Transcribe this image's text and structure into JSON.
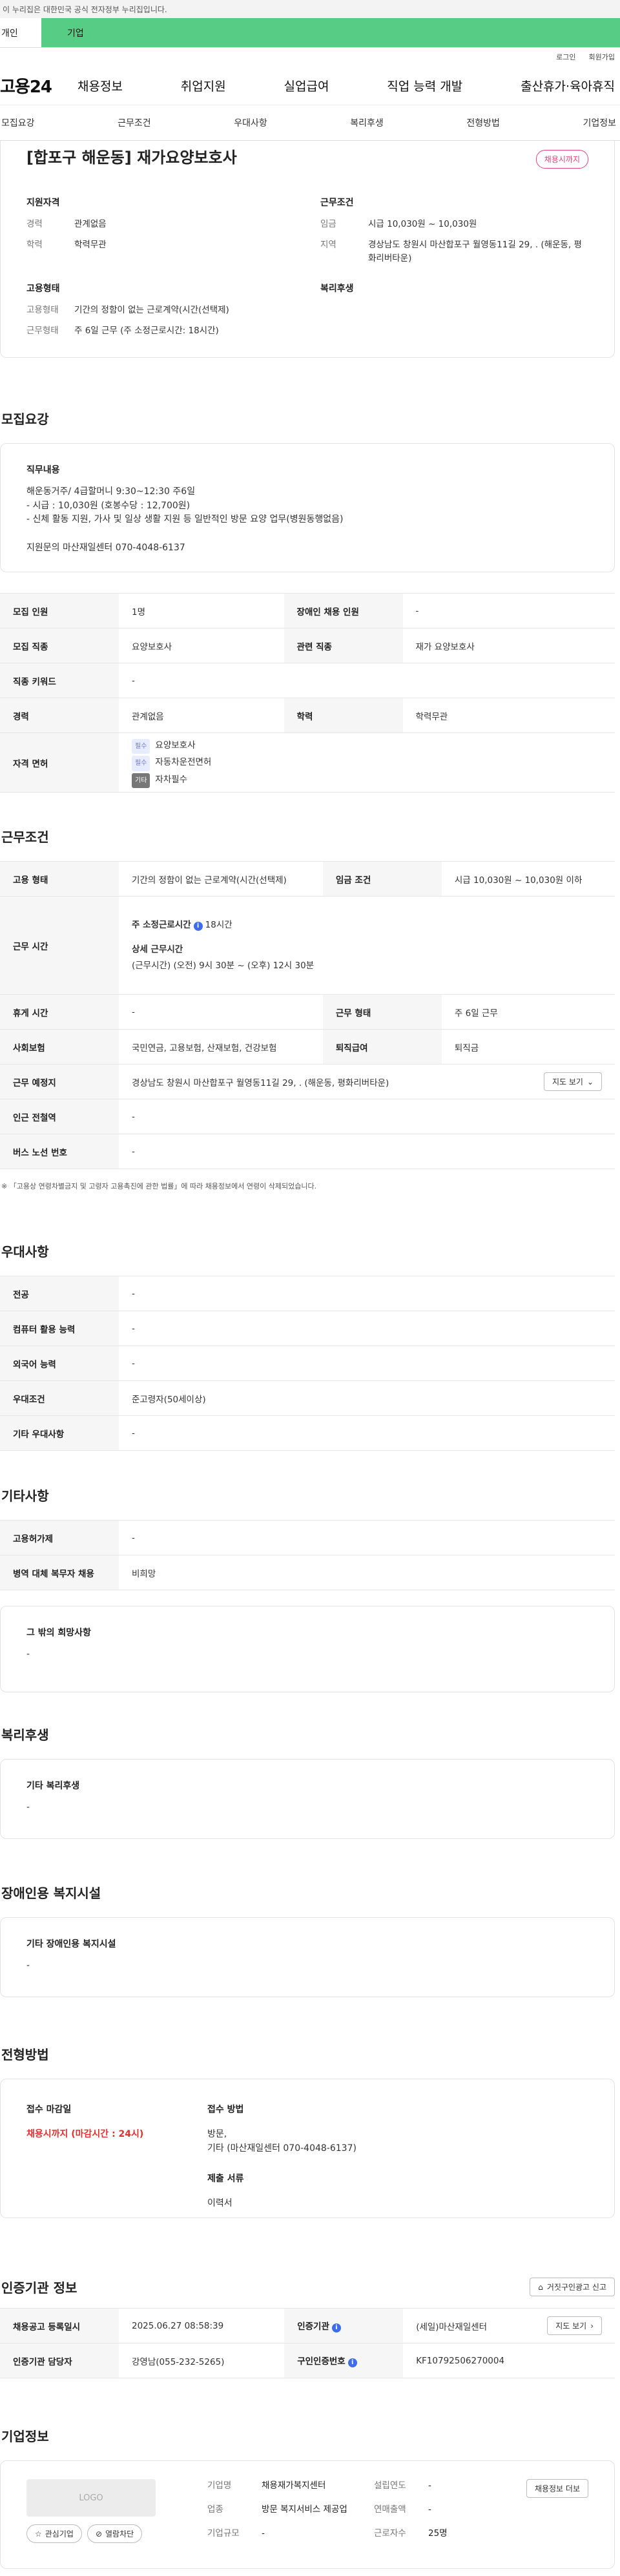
{
  "gov_notice": "이 누리집은 대한민국 공식 전자정부 누리집입니다.",
  "top_tabs": {
    "personal": "개인",
    "company": "기업"
  },
  "util": {
    "login": "로그인",
    "join": "회원가입"
  },
  "gnb": {
    "logo": "고용24",
    "menu": [
      "채용정보",
      "취업지원",
      "실업급여",
      "직업 능력 개발",
      "출산휴가·육아휴직"
    ]
  },
  "subnav": [
    "모집요강",
    "근무조건",
    "우대사항",
    "복리후생",
    "전형방법",
    "기업정보"
  ],
  "summary": {
    "title": "[합포구 해운동] 재가요양보호사",
    "status_badge": "채용시까지",
    "applicant": {
      "heading": "지원자격",
      "career_k": "경력",
      "career_v": "관계없음",
      "edu_k": "학력",
      "edu_v": "학력무관"
    },
    "work": {
      "heading": "근무조건",
      "wage_k": "임금",
      "wage_v": "시급 10,030원 ~ 10,030원",
      "region_k": "지역",
      "region_v": "경상남도 창원시 마산합포구 월영동11길 29, . (해운동, 평화리버타운)"
    },
    "employment": {
      "heading": "고용형태",
      "type_k": "고용형태",
      "type_v": "기간의 정함이 없는 근로계약(시간(선택제)",
      "shift_k": "근무형태",
      "shift_v": "주 6일 근무 (주 소정근로시간: 18시간)"
    },
    "welfare": {
      "heading": "복리후생"
    }
  },
  "recruit": {
    "section_title": "모집요강",
    "duty_heading": "직무내용",
    "duty_text": "해운동거주/ 4급할머니 9:30~12:30 주6일\n- 시급 : 10,030원 (호봉수당 : 12,700원)\n- 신체 활동 지원, 가사 및 일상 생활 지원 등 일반적인 방문 요양 업무(병원동행없음)\n\n지원문의 마산재일센터 070-4048-6137",
    "rows": {
      "headcount_k": "모집 인원",
      "headcount_v": "1명",
      "disabled_k": "장애인 채용 인원",
      "disabled_v": "-",
      "job_k": "모집 직종",
      "job_v": "요양보호사",
      "related_k": "관련 직종",
      "related_v": "재가 요양보호사",
      "keyword_k": "직종 키워드",
      "keyword_v": "-",
      "career_k": "경력",
      "career_v": "관계없음",
      "edu_k": "학력",
      "edu_v": "학력무관",
      "license_k": "자격 면허",
      "licenses": [
        {
          "badge": "필수",
          "name": "요양보호사"
        },
        {
          "badge": "필수",
          "name": "자동차운전면허"
        },
        {
          "badge": "기타",
          "name": "자차필수"
        }
      ]
    }
  },
  "conditions": {
    "section_title": "근무조건",
    "emp_type_k": "고용 형태",
    "emp_type_v": "기간의 정함이 없는 근로계약(시간(선택제)",
    "wage_k": "임금 조건",
    "wage_v": "시급 10,030원 ~ 10,030원 이하",
    "time_k": "근무 시간",
    "weekly_label": "주 소정근로시간",
    "weekly_value": "18시간",
    "detail_label": "상세 근무시간",
    "detail_value": "(근무시간) (오전) 9시 30분 ~ (오후) 12시 30분",
    "holiday_k": "휴게 시간",
    "holiday_v": "-",
    "shift_k": "근무 형태",
    "shift_v": "주 6일 근무",
    "insurance_k": "사회보험",
    "insurance_v": "국민연금, 고용보험, 산재보험, 건강보험",
    "severance_k": "퇴직급여",
    "severance_v": "퇴직금",
    "place_k": "근무 예정지",
    "place_v": "경상남도 창원시 마산합포구 월영동11길 29, . (해운동, 평화리버타운)",
    "map_btn": "지도 보기",
    "subway_k": "인근 전철역",
    "subway_v": "-",
    "bus_k": "버스 노선 번호",
    "bus_v": "-",
    "note": "「고용상 연령차별금지 및 고령자 고용촉진에 관한 법률」에 따라 채용정보에서 연령이 삭제되었습니다."
  },
  "preference": {
    "section_title": "우대사항",
    "major_k": "전공",
    "major_v": "-",
    "computer_k": "컴퓨터 활용 능력",
    "computer_v": "-",
    "language_k": "외국어 능력",
    "language_v": "-",
    "cond_k": "우대조건",
    "cond_v": "준고령자(50세이상)",
    "etc_k": "기타 우대사항",
    "etc_v": "-"
  },
  "others": {
    "section_title": "기타사항",
    "disabled_k": "고용허가제",
    "disabled_v": "-",
    "military_k": "병역 대체 복무자 채용",
    "military_v": "비희망",
    "wish_heading": "그 밖의 희망사항",
    "wish_v": "-"
  },
  "welfare": {
    "section_title": "복리후생",
    "heading": "기타 복리후생",
    "value": "-"
  },
  "disability_facility": {
    "section_title": "장애인용 복지시설",
    "heading": "기타 장애인용 복지시설",
    "value": "-"
  },
  "apply": {
    "section_title": "전형방법",
    "deadline_h": "접수 마감일",
    "deadline_v": "채용시까지 (마감시간 : 24시)",
    "method_h": "접수 방법",
    "method_v": "방문,\n기타 (마산재일센터 070-4048-6137)",
    "docs_h": "제출 서류",
    "docs_v": "이력서"
  },
  "agency": {
    "section_title": "인증기관 정보",
    "report_btn": "거짓구인광고 신고",
    "date_k": "채용공고 등록일시",
    "date_v": "2025.06.27 08:58:39",
    "org_k": "인증기관",
    "org_v": "(세일)마산재일센터",
    "map_btn": "지도 보기",
    "manager_k": "인증기관 담당자",
    "manager_v": "강영남(055-232-5265)",
    "regno_k": "구인인증번호",
    "regno_v": "KF10792506270004"
  },
  "company": {
    "section_title": "기업정보",
    "logo": "LOGO",
    "fav_btn": "관심기업",
    "block_btn": "열람차단",
    "name_k": "기업명",
    "name_v": "채용재가복지센터",
    "industry_k": "업종",
    "industry_v": "방문 복지서비스 제공업",
    "scale_k": "기업규모",
    "scale_v": "-",
    "founded_k": "설립연도",
    "founded_v": "-",
    "revenue_k": "연매출액",
    "revenue_v": "-",
    "employees_k": "근로자수",
    "employees_v": "25명",
    "more_btn": "채용정보 더보"
  }
}
